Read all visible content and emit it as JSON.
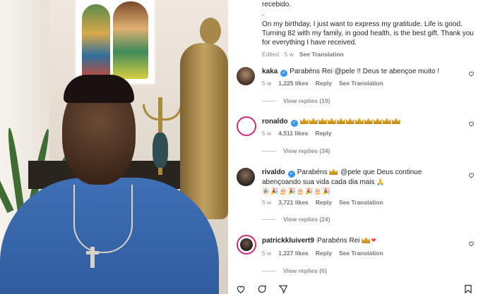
{
  "caption": {
    "lines": [
      "recebido.",
      ".",
      "On my birthday, I just want to express my gratitude. Life is good. Turning 82 with my family, in good health, is the best gift. Thank you for everything I have received."
    ],
    "edited": "Edited · 5 w",
    "see_translation": "See Translation"
  },
  "comments": [
    {
      "username": "kaka",
      "verified": true,
      "text": "Parabéns Rei @pele !! Deus te abençoe muito !",
      "age": "5 w",
      "likes": "1,225 likes",
      "reply": "Reply",
      "see_translation": "See Translation",
      "view_replies": "View replies (19)"
    },
    {
      "username": "ronaldo",
      "verified": true,
      "crowns": 11,
      "age": "5 w",
      "likes": "4,511 likes",
      "reply": "Reply",
      "view_replies": "View replies (34)"
    },
    {
      "username": "rivaldo",
      "verified": true,
      "text_before": "Parabéns",
      "text_after": "@pele que Deus continue abençoando sua vida cada dia mais",
      "emoji_line": "🪅🎉🎂🎉🎂🎉🎂🎉",
      "age": "5 w",
      "likes": "3,721 likes",
      "reply": "Reply",
      "see_translation": "See Translation",
      "view_replies": "View replies (24)"
    },
    {
      "username": "patrickkluivert9",
      "verified": false,
      "text": "Parabéns Rei",
      "age": "5 w",
      "likes": "1,227 likes",
      "reply": "Reply",
      "see_translation": "See Translation",
      "view_replies": "View replies (6)"
    }
  ],
  "colors": {
    "verified": "#3897f0",
    "muted": "#8e8e8e",
    "heart_red": "#ed4956",
    "crown": "#e9b83a"
  },
  "icons": [
    "heart-icon",
    "comment-icon",
    "share-icon",
    "bookmark-icon"
  ]
}
